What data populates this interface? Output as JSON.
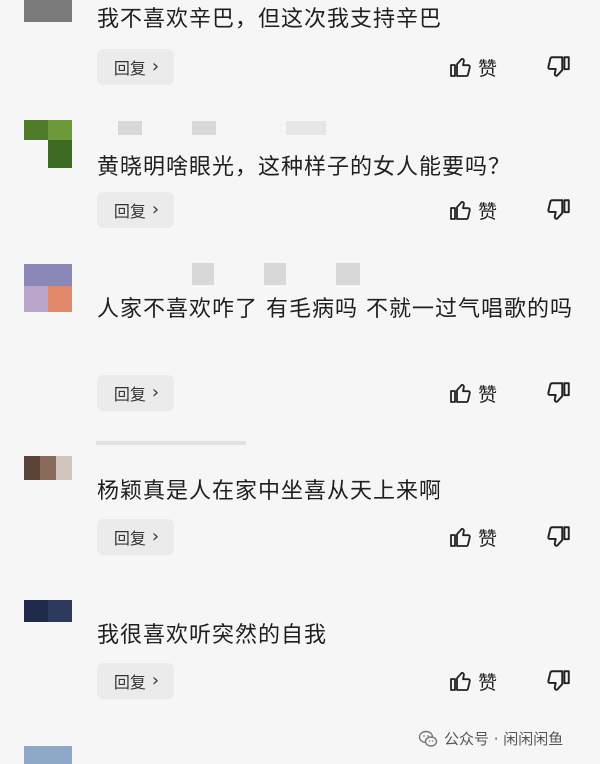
{
  "comments": [
    {
      "text": "我不喜欢辛巴，但这次我支持辛巴",
      "reply_label": "回复",
      "like_label": "赞",
      "avatar_colors": [
        "#7a7a7a"
      ]
    },
    {
      "text": "黄晓明啥眼光，这种样子的女人能要吗？",
      "reply_label": "回复",
      "like_label": "赞",
      "avatar_colors": [
        "#4e7a2a",
        "#6f9a3a",
        "#3d6b22"
      ]
    },
    {
      "text": "人家不喜欢咋了 有毛病吗 不就一过气唱歌的吗",
      "reply_label": "回复",
      "like_label": "赞",
      "avatar_colors": [
        "#8a88b8",
        "#e0896a",
        "#b9a6c8"
      ]
    },
    {
      "text": "杨颖真是人在家中坐喜从天上来啊",
      "reply_label": "回复",
      "like_label": "赞",
      "avatar_colors": [
        "#5a4438",
        "#8a6a5a",
        "#d0c4bc"
      ]
    },
    {
      "text": "我很喜欢听突然的自我",
      "reply_label": "回复",
      "like_label": "赞",
      "avatar_colors": [
        "#1f2a4a",
        "#2c3a5e"
      ]
    }
  ],
  "watermark": {
    "text": "公众号 · 闲闲闲鱼"
  }
}
